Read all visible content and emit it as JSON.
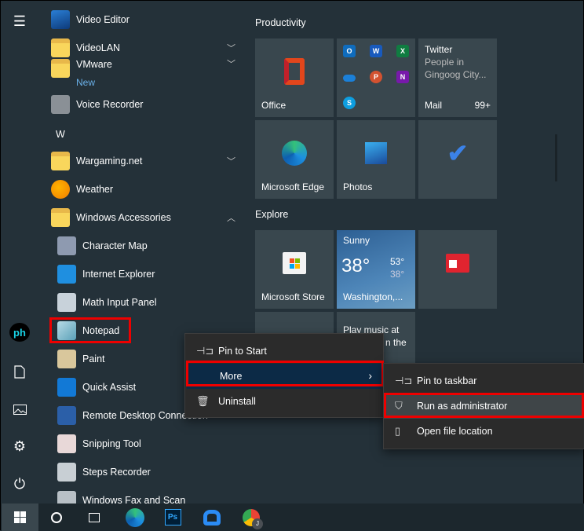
{
  "app_list": [
    {
      "label": "Video Editor",
      "icon": "video-editor-icon",
      "type": "app"
    },
    {
      "label": "VideoLAN",
      "icon": "folder-icon",
      "type": "folder",
      "expand": "collapsed"
    },
    {
      "label": "VMware",
      "icon": "folder-icon",
      "type": "folder",
      "expand": "collapsed",
      "badge": "New"
    },
    {
      "label": "Voice Recorder",
      "icon": "microphone-icon",
      "type": "app"
    },
    {
      "label": "W",
      "type": "letter"
    },
    {
      "label": "Wargaming.net",
      "icon": "folder-icon",
      "type": "folder",
      "expand": "collapsed"
    },
    {
      "label": "Weather",
      "icon": "weather-icon",
      "type": "app"
    },
    {
      "label": "Windows Accessories",
      "icon": "folder-icon",
      "type": "folder",
      "expand": "expanded"
    },
    {
      "label": "Character Map",
      "icon": "character-map-icon",
      "type": "sub"
    },
    {
      "label": "Internet Explorer",
      "icon": "internet-explorer-icon",
      "type": "sub"
    },
    {
      "label": "Math Input Panel",
      "icon": "math-input-icon",
      "type": "sub"
    },
    {
      "label": "Notepad",
      "icon": "notepad-icon",
      "type": "sub"
    },
    {
      "label": "Paint",
      "icon": "paint-icon",
      "type": "sub"
    },
    {
      "label": "Quick Assist",
      "icon": "quick-assist-icon",
      "type": "sub"
    },
    {
      "label": "Remote Desktop Connection",
      "icon": "remote-desktop-icon",
      "type": "sub"
    },
    {
      "label": "Snipping Tool",
      "icon": "snipping-tool-icon",
      "type": "sub"
    },
    {
      "label": "Steps Recorder",
      "icon": "steps-recorder-icon",
      "type": "sub"
    },
    {
      "label": "Windows Fax and Scan",
      "icon": "fax-icon",
      "type": "sub"
    }
  ],
  "groups": {
    "productivity": "Productivity",
    "explore": "Explore"
  },
  "tiles": {
    "office": "Office",
    "twitter": {
      "title": "Twitter",
      "line1": "People in",
      "line2": "Gingoog City...",
      "app": "Mail",
      "count": "99+"
    },
    "edge": "Microsoft Edge",
    "photos": "Photos",
    "store": "Microsoft Store",
    "weather": {
      "condition": "Sunny",
      "temp": "38°",
      "high": "53°",
      "low": "38°",
      "location": "Washington,..."
    },
    "music": {
      "line1": "Play music at",
      "line2": "n the"
    }
  },
  "office_apps": [
    "O",
    "W",
    "X",
    "",
    "P",
    "N",
    "S"
  ],
  "context_menu": {
    "pin_start": "Pin to Start",
    "more": "More",
    "uninstall": "Uninstall"
  },
  "submenu": {
    "pin_taskbar": "Pin to taskbar",
    "run_admin": "Run as administrator",
    "open_location": "Open file location"
  },
  "rail": {
    "user_initials": "ph"
  },
  "taskbar": {
    "chrome_profile": "J"
  },
  "colors": {
    "highlight": "#e00000",
    "menu_selected": "#0c2a46",
    "accent": "#0078d7"
  }
}
